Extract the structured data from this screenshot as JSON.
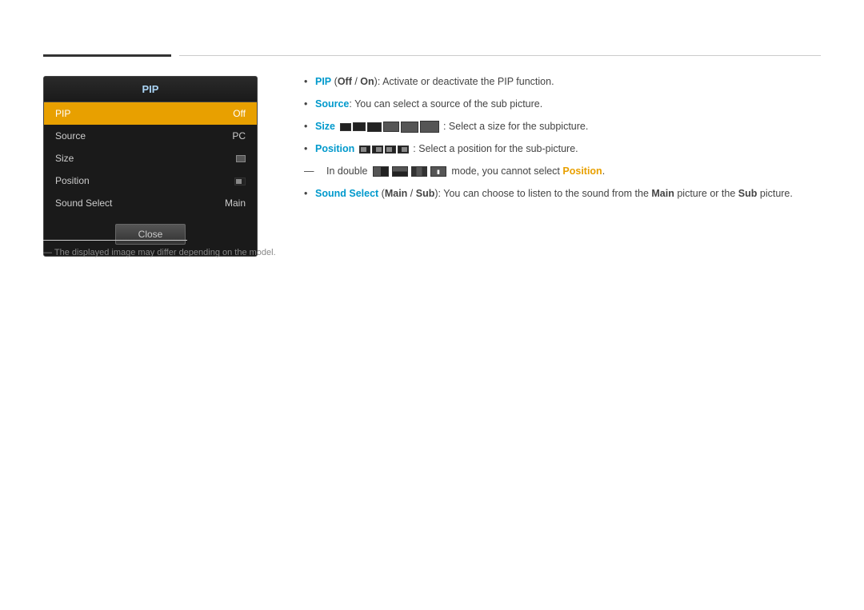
{
  "page": {
    "top_rule": true
  },
  "pip_panel": {
    "title": "PIP",
    "menu_items": [
      {
        "label": "PIP",
        "value": "Off",
        "active": true
      },
      {
        "label": "Source",
        "value": "PC",
        "active": false
      },
      {
        "label": "Size",
        "value": "",
        "active": false
      },
      {
        "label": "Position",
        "value": "",
        "active": false
      },
      {
        "label": "Sound Select",
        "value": "Main",
        "active": false
      }
    ],
    "close_button": "Close"
  },
  "note": "― The displayed image may differ depending on the model.",
  "description": {
    "bullets": [
      {
        "id": "pip",
        "bold_start": "PIP",
        "highlight_off": "Off",
        "highlight_on": "On",
        "rest": ": Activate or deactivate the PIP function."
      },
      {
        "id": "source",
        "bold_start": "Source",
        "rest": ": You can select a source of the sub picture."
      },
      {
        "id": "size",
        "bold_start": "Size",
        "rest": ": Select a size for the subpicture."
      },
      {
        "id": "position",
        "bold_start": "Position",
        "rest": ": Select a position for the sub-picture."
      },
      {
        "id": "position_note",
        "rest": "mode, you cannot select",
        "bold_end": "Position",
        "indent": true
      },
      {
        "id": "sound_select",
        "bold_start": "Sound Select",
        "highlight_main": "Main",
        "highlight_sub": "Sub",
        "rest": ": You can choose to listen to the sound from the",
        "rest2": "picture or the",
        "rest3": "picture."
      }
    ]
  }
}
